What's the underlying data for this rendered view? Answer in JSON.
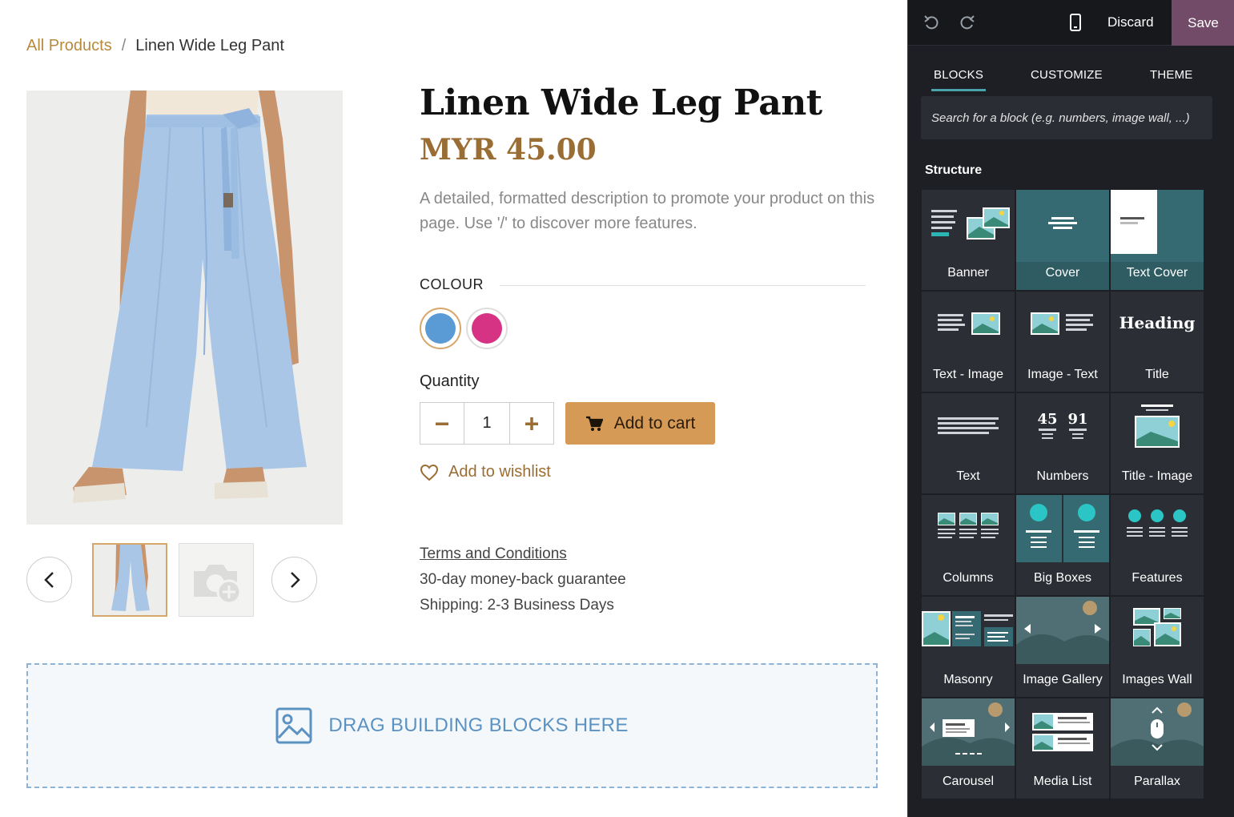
{
  "breadcrumb": {
    "parent": "All Products",
    "separator": "/",
    "current": "Linen Wide Leg Pant"
  },
  "product": {
    "title": "Linen Wide Leg Pant",
    "price": "MYR 45.00",
    "description": "A detailed, formatted description to promote your product on this page. Use '/' to discover more features.",
    "colour_label": "COLOUR",
    "colours": [
      {
        "name": "blue",
        "hex": "#5b9bd5",
        "selected": true
      },
      {
        "name": "pink",
        "hex": "#d63384",
        "selected": false
      }
    ],
    "quantity_label": "Quantity",
    "quantity_value": "1",
    "add_to_cart": "Add to cart",
    "wishlist": "Add to wishlist",
    "terms": "Terms and Conditions",
    "guarantee": "30-day money-back guarantee",
    "shipping": "Shipping: 2-3 Business Days"
  },
  "dropzone": {
    "label": "DRAG BUILDING BLOCKS HERE"
  },
  "editor": {
    "topbar": {
      "discard": "Discard",
      "save": "Save"
    },
    "tabs": [
      "BLOCKS",
      "CUSTOMIZE",
      "THEME"
    ],
    "search_placeholder": "Search for a block (e.g. numbers, image wall, ...)",
    "section_title": "Structure",
    "blocks": [
      "Banner",
      "Cover",
      "Text Cover",
      "Text - Image",
      "Image - Text",
      "Title",
      "Text",
      "Numbers",
      "Title - Image",
      "Columns",
      "Big Boxes",
      "Features",
      "Masonry",
      "Image Gallery",
      "Images Wall",
      "Carousel",
      "Media List",
      "Parallax"
    ],
    "heading_thumb_text": "Heading",
    "numbers_thumb": [
      "45",
      "91"
    ]
  },
  "colors": {
    "accent": "#9a6d35",
    "cart_button": "#d59a55",
    "save_button": "#714b67",
    "tab_underline": "#4aa3a8"
  }
}
